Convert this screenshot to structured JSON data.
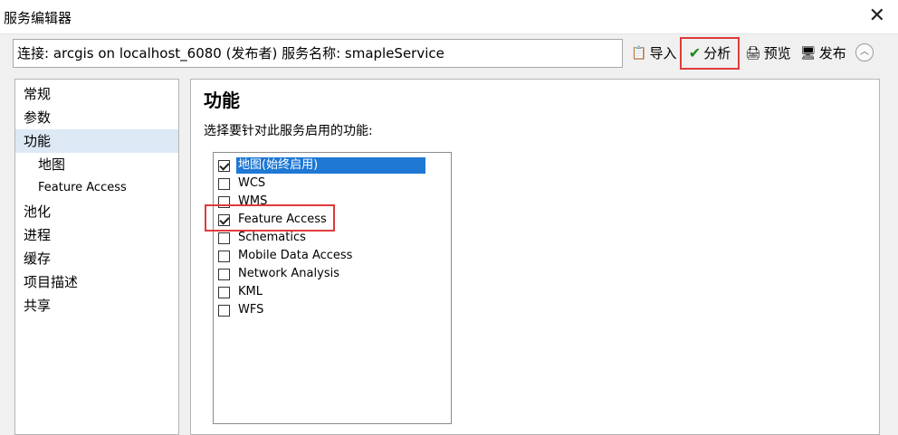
{
  "window": {
    "title": "服务编辑器",
    "close": "✕"
  },
  "toolbar": {
    "connection": "连接: arcgis on localhost_6080 (发布者)   服务名称: smapleService",
    "import": "导入",
    "analyze": "分析",
    "preview": "预览",
    "publish": "发布",
    "collapse": "︿"
  },
  "icons": {
    "import": "📋",
    "analyze": "✔",
    "preview": "🖨",
    "publish": "🖥"
  },
  "colors": {
    "selection": "#1e78d4",
    "highlight": "#e03a3a",
    "check": "#1a8a1a"
  },
  "sidebar": {
    "items": [
      {
        "label": "常规"
      },
      {
        "label": "参数"
      },
      {
        "label": "功能"
      },
      {
        "label": "地图"
      },
      {
        "label": "Feature Access"
      },
      {
        "label": "池化"
      },
      {
        "label": "进程"
      },
      {
        "label": "缓存"
      },
      {
        "label": "项目描述"
      },
      {
        "label": "共享"
      }
    ]
  },
  "main": {
    "title": "功能",
    "prompt": "选择要针对此服务启用的功能:",
    "capabilities": [
      {
        "label": "地图(始终启用)",
        "checked": true
      },
      {
        "label": "WCS",
        "checked": false
      },
      {
        "label": "WMS",
        "checked": false
      },
      {
        "label": "Feature Access",
        "checked": true
      },
      {
        "label": "Schematics",
        "checked": false
      },
      {
        "label": "Mobile Data Access",
        "checked": false
      },
      {
        "label": "Network Analysis",
        "checked": false
      },
      {
        "label": "KML",
        "checked": false
      },
      {
        "label": "WFS",
        "checked": false
      }
    ]
  }
}
